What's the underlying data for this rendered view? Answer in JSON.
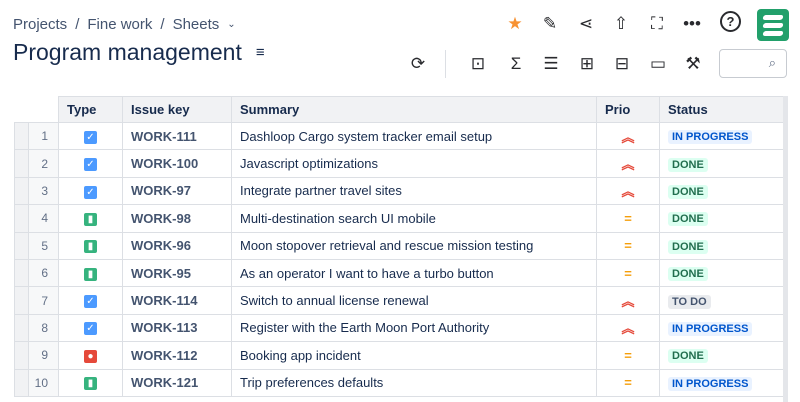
{
  "breadcrumb": {
    "items": [
      "Projects",
      "Fine work",
      "Sheets"
    ]
  },
  "page_title": "Program management",
  "toolbar_icons": [
    "star-icon",
    "edit-icon",
    "share-icon",
    "export-icon",
    "fullscreen-icon",
    "more-icon",
    "help-icon"
  ],
  "search": {
    "placeholder": ""
  },
  "table": {
    "columns": [
      "Type",
      "Issue key",
      "Summary",
      "Prio",
      "Status"
    ],
    "rows": [
      {
        "n": "1",
        "type": "task",
        "key": "WORK-111",
        "summary": "Dashloop Cargo system tracker email setup",
        "prio": "high",
        "status": "IN PROGRESS"
      },
      {
        "n": "2",
        "type": "task",
        "key": "WORK-100",
        "summary": "Javascript optimizations",
        "prio": "high",
        "status": "DONE"
      },
      {
        "n": "3",
        "type": "task",
        "key": "WORK-97",
        "summary": "Integrate partner travel sites",
        "prio": "high",
        "status": "DONE"
      },
      {
        "n": "4",
        "type": "story",
        "key": "WORK-98",
        "summary": "Multi-destination search UI mobile",
        "prio": "medium",
        "status": "DONE"
      },
      {
        "n": "5",
        "type": "story",
        "key": "WORK-96",
        "summary": "Moon stopover retrieval and rescue mission testing",
        "prio": "medium",
        "status": "DONE"
      },
      {
        "n": "6",
        "type": "story",
        "key": "WORK-95",
        "summary": "As an operator I want to have a turbo button",
        "prio": "medium",
        "status": "DONE"
      },
      {
        "n": "7",
        "type": "task",
        "key": "WORK-114",
        "summary": "Switch to annual license renewal",
        "prio": "high",
        "status": "TO DO"
      },
      {
        "n": "8",
        "type": "task",
        "key": "WORK-113",
        "summary": "Register with the Earth Moon Port Authority",
        "prio": "high",
        "status": "IN PROGRESS"
      },
      {
        "n": "9",
        "type": "bug",
        "key": "WORK-112",
        "summary": "Booking app incident",
        "prio": "medium",
        "status": "DONE"
      },
      {
        "n": "10",
        "type": "story",
        "key": "WORK-121",
        "summary": "Trip preferences defaults",
        "prio": "medium",
        "status": "IN PROGRESS"
      }
    ]
  },
  "colors": {
    "task": "#4c9aff",
    "story": "#36b37e",
    "bug": "#e5493a",
    "high": "#e5493a",
    "medium": "#f59e0b",
    "star": "#f79233",
    "brand": "#22a06b"
  }
}
